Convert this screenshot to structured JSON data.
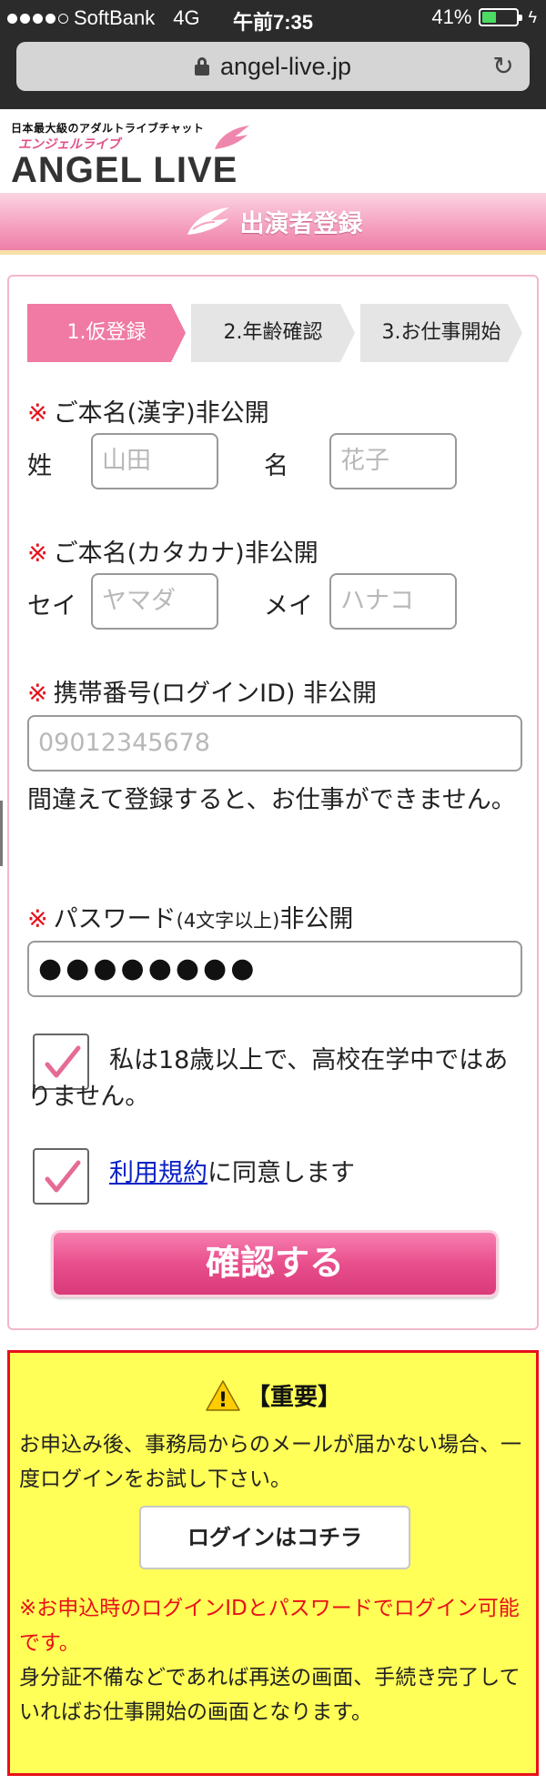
{
  "status_bar": {
    "carrier": "SoftBank",
    "network": "4G",
    "time": "午前7:35",
    "battery_percent": "41%",
    "battery_level": 0.41,
    "signal_bars": 4
  },
  "browser": {
    "url": "angel-live.jp"
  },
  "header": {
    "tagline": "日本最大級のアダルトライブチャット",
    "logo_kana": "エンジェルライブ",
    "logo_text": "ANGEL LIVE",
    "page_title": "出演者登録"
  },
  "steps": [
    {
      "label": "1.仮登録"
    },
    {
      "label": "2.年齢確認"
    },
    {
      "label": "3.お仕事開始"
    }
  ],
  "form": {
    "required_mark": "※",
    "name_kanji": {
      "label": "ご本名(漢字)非公開",
      "last_label": "姓",
      "last_placeholder": "山田",
      "first_label": "名",
      "first_placeholder": "花子"
    },
    "name_kana": {
      "label": "ご本名(カタカナ)非公開",
      "last_label": "セイ",
      "last_placeholder": "ヤマダ",
      "first_label": "メイ",
      "first_placeholder": "ハナコ"
    },
    "phone": {
      "label": "携帯番号(ログインID) 非公開",
      "placeholder": "09012345678",
      "note": "間違えて登録すると、お仕事ができません。"
    },
    "password": {
      "label_main": "パスワード",
      "label_small": "(4文字以上)",
      "label_suffix": "非公開",
      "value": "●●●●●●●●"
    },
    "age_check": {
      "checked": true,
      "text": "私は18歳以上で、高校在学中ではありません。"
    },
    "terms_check": {
      "checked": true,
      "link_text": "利用規約",
      "text": "に同意します"
    },
    "submit_label": "確認する"
  },
  "important": {
    "title": "【重要】",
    "warning_icon": "!",
    "message": "お申込み後、事務局からのメールが届かない場合、一度ログインをお試し下さい。",
    "login_button": "ログインはコチラ",
    "red_note": "※お申込時のログインIDとパスワードでログイン可能です。",
    "note": "身分証不備などであれば再送の画面、手続き完了していればお仕事開始の画面となります。"
  },
  "colors": {
    "accent_pink": "#f07aa3",
    "required_red": "#e8101a",
    "link_blue": "#0b22c4",
    "important_bg": "#ffff57"
  },
  "icons": {
    "lock": "lock-icon",
    "reload": "reload-icon",
    "wing": "wing-icon",
    "warning": "warning-icon",
    "checkmark": "checkmark-icon"
  }
}
